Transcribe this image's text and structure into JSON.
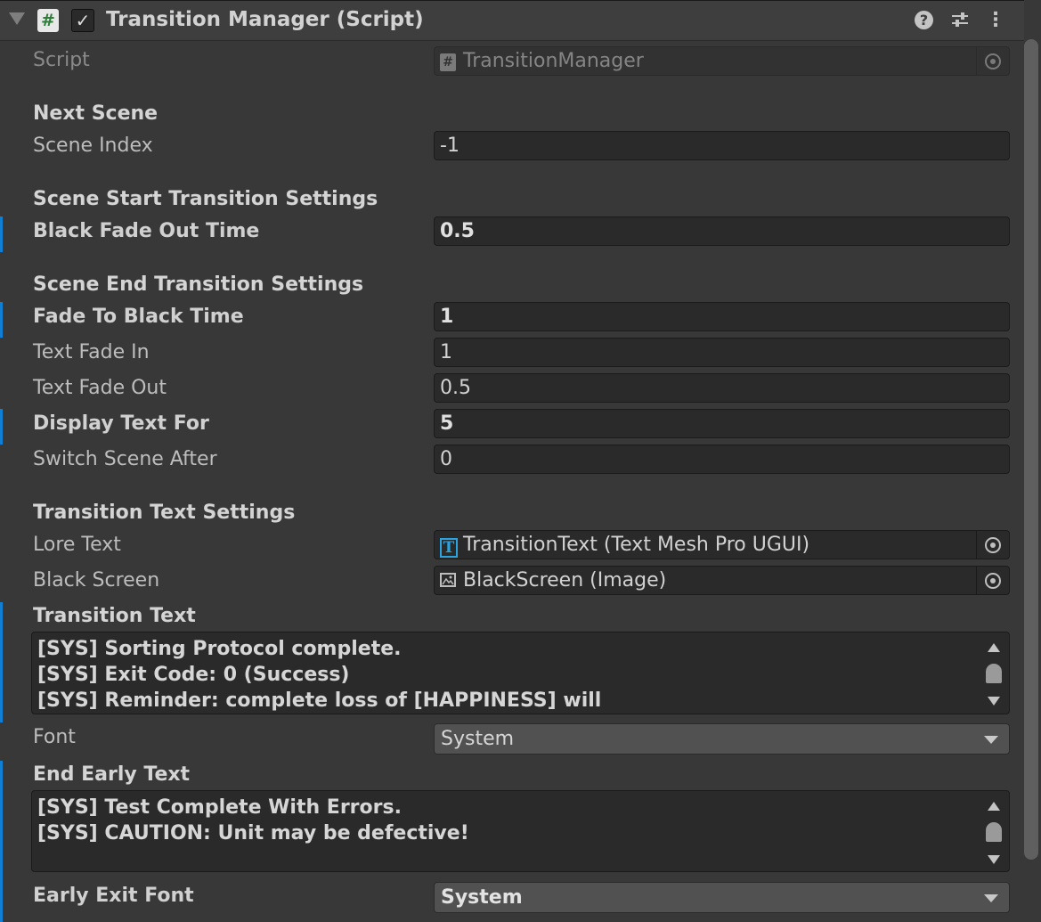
{
  "header": {
    "title": "Transition Manager (Script)",
    "script_icon_glyph": "#",
    "enabled_check_glyph": "✓",
    "help_glyph": "?",
    "menu_glyph": "⋮"
  },
  "fields": {
    "script": {
      "label": "Script",
      "value": "TransitionManager",
      "icon": "cs-script-icon"
    },
    "next_scene": {
      "heading": "Next Scene"
    },
    "scene_index": {
      "label": "Scene Index",
      "value": "-1"
    },
    "start_transition": {
      "heading": "Scene Start Transition Settings"
    },
    "black_fade_out_time": {
      "label": "Black Fade Out Time",
      "value": "0.5",
      "overridden": true
    },
    "end_transition": {
      "heading": "Scene End Transition Settings"
    },
    "fade_to_black_time": {
      "label": "Fade To Black Time",
      "value": "1",
      "overridden": true
    },
    "text_fade_in": {
      "label": "Text Fade In",
      "value": "1"
    },
    "text_fade_out": {
      "label": "Text Fade Out",
      "value": "0.5"
    },
    "display_text_for": {
      "label": "Display Text For",
      "value": "5",
      "overridden": true
    },
    "switch_scene_after": {
      "label": "Switch Scene After",
      "value": "0"
    },
    "text_settings": {
      "heading": "Transition Text Settings"
    },
    "lore_text": {
      "label": "Lore Text",
      "value": "TransitionText (Text Mesh Pro UGUI)",
      "icon_glyph": "T"
    },
    "black_screen": {
      "label": "Black Screen",
      "value": "BlackScreen (Image)",
      "icon": "image-icon"
    },
    "transition_text": {
      "label": "Transition Text",
      "lines": [
        "[SYS] Sorting Protocol complete.",
        "[SYS] Exit Code: 0 (Success)",
        "[SYS] Reminder: complete loss of [HAPPINESS] will"
      ],
      "overridden": true
    },
    "font": {
      "label": "Font",
      "value": "System"
    },
    "end_early_text": {
      "label": "End Early Text",
      "lines": [
        "[SYS] Test Complete With Errors.",
        "[SYS] CAUTION: Unit may be defective!"
      ],
      "overridden": true
    },
    "early_exit_font": {
      "label": "Early Exit Font",
      "value": "System",
      "overridden": true
    }
  },
  "colors": {
    "background": "#383838",
    "field_bg": "#2a2a2a",
    "override_bar": "#0f7fd6",
    "tmp_icon": "#2aa3e0"
  }
}
